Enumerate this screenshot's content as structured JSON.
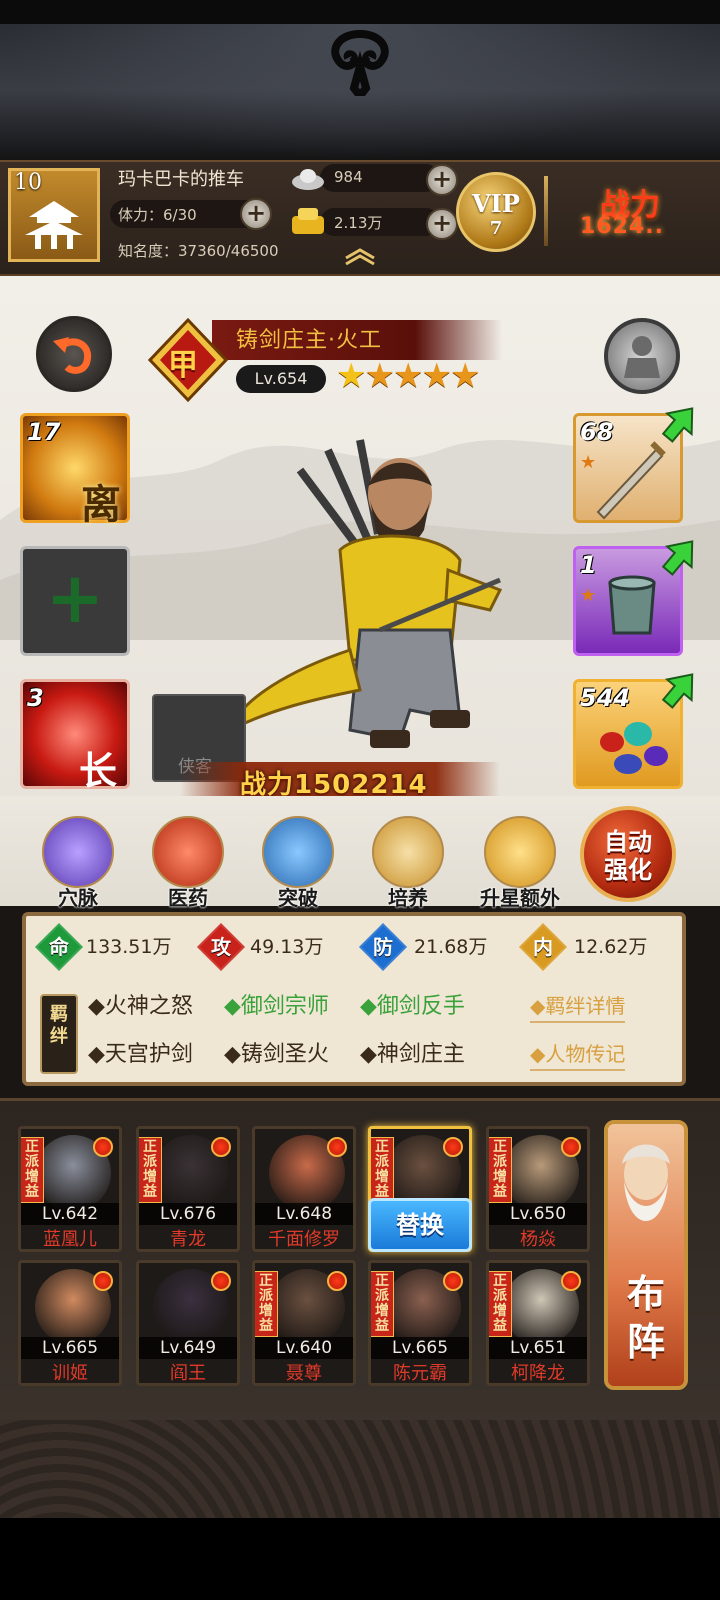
{
  "player": {
    "level": "10",
    "name": "玛卡巴卡的推车",
    "stamina_label": "体力：6/30",
    "fame_label": "知名度：37360/46500",
    "silver": "984",
    "gold": "2.13万",
    "vip_label": "VIP",
    "vip_level": "7",
    "power_label": "战力",
    "power_value": "1624.."
  },
  "hero": {
    "name": "铸剑庄主·火工",
    "level": "Lv.654",
    "stars": [
      "★",
      "★",
      "★",
      "★",
      "★"
    ],
    "power": "战力1502214",
    "placeholder_text": "侠客",
    "grade_char": "甲"
  },
  "slots": {
    "left": [
      {
        "count": "17",
        "char": "离",
        "icon": "fire-skill-icon"
      },
      {
        "count": "",
        "char": "+",
        "icon": "add-slot-icon"
      },
      {
        "count": "3",
        "char": "长",
        "icon": "red-skill-icon"
      }
    ],
    "right": [
      {
        "count": "68",
        "icon": "sword-equip-icon"
      },
      {
        "count": "1",
        "icon": "jade-bracer-icon"
      },
      {
        "count": "544",
        "icon": "gems-icon"
      }
    ]
  },
  "actions": [
    {
      "label": "穴脉",
      "icon": "meridian-icon"
    },
    {
      "label": "医药",
      "icon": "medicine-icon"
    },
    {
      "label": "突破",
      "icon": "breakthrough-icon"
    },
    {
      "label": "培养",
      "icon": "cultivate-icon"
    },
    {
      "label": "升星额外",
      "icon": "star-upgrade-icon"
    }
  ],
  "auto_button": [
    "自动",
    "强化"
  ],
  "attributes": [
    {
      "char": "命",
      "value": "133.51万",
      "color": "#1f9a3a"
    },
    {
      "char": "攻",
      "value": "49.13万",
      "color": "#c8221a"
    },
    {
      "char": "防",
      "value": "21.68万",
      "color": "#1c6ed0"
    },
    {
      "char": "内",
      "value": "12.62万",
      "color": "#d89a20"
    }
  ],
  "bonds": {
    "label": "羁绊",
    "row1": [
      {
        "text": "◆火神之怒",
        "active": false
      },
      {
        "text": "◆御剑宗师",
        "active": true
      },
      {
        "text": "◆御剑反手",
        "active": true
      }
    ],
    "row2": [
      {
        "text": "◆天宫护剑",
        "active": false
      },
      {
        "text": "◆铸剑圣火",
        "active": false
      },
      {
        "text": "◆神剑庄主",
        "active": false
      }
    ],
    "detail_link": "◆羁绊详情",
    "bio_link": "◆人物传记"
  },
  "team": {
    "tag": "正派增益",
    "replace_label": "替换",
    "formation_label": "布阵",
    "row1": [
      {
        "level": "Lv.642",
        "name": "蓝凰儿",
        "tag": true,
        "color": "#8a8f9c"
      },
      {
        "level": "Lv.676",
        "name": "青龙",
        "tag": true,
        "color": "#3a3236"
      },
      {
        "level": "Lv.648",
        "name": "千面修罗",
        "tag": false,
        "color": "#c86a4a"
      },
      {
        "level": "",
        "name": "",
        "tag": true,
        "color": "#6a5040"
      },
      {
        "level": "Lv.650",
        "name": "杨焱",
        "tag": true,
        "color": "#b89a7a"
      }
    ],
    "row2": [
      {
        "level": "Lv.665",
        "name": "训姬",
        "tag": false,
        "color": "#d08a60"
      },
      {
        "level": "Lv.649",
        "name": "阎王",
        "tag": false,
        "color": "#3a3040"
      },
      {
        "level": "Lv.640",
        "name": "聂尊",
        "tag": true,
        "color": "#6a5040"
      },
      {
        "level": "Lv.665",
        "name": "陈元霸",
        "tag": true,
        "color": "#8a6050"
      },
      {
        "level": "Lv.651",
        "name": "柯降龙",
        "tag": true,
        "color": "#cfc6b6"
      }
    ]
  },
  "colors": {
    "accent_gold": "#e3b457",
    "active_bond": "#3aa23a",
    "enemy_red": "#e03a2a"
  }
}
